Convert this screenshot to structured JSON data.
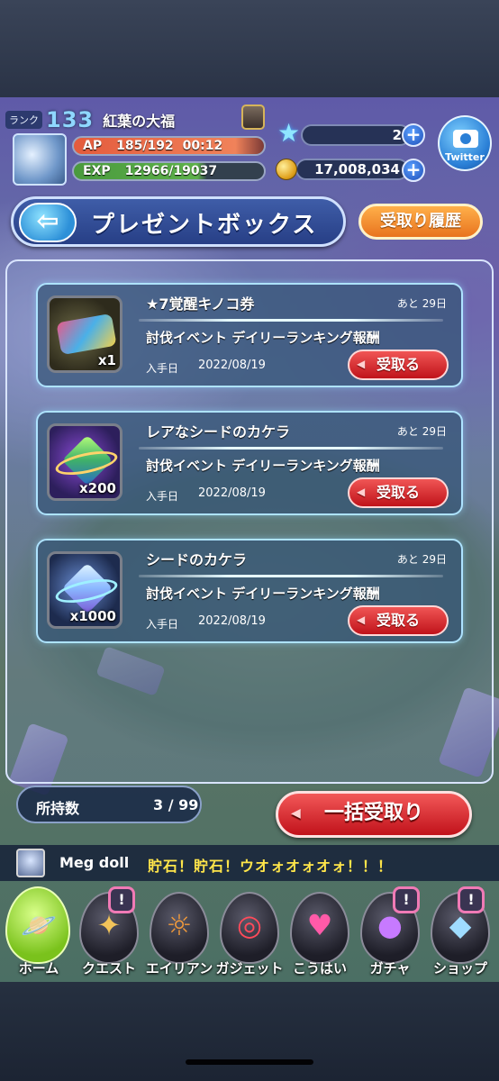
{
  "header": {
    "rank_label": "ランク",
    "rank_value": "133",
    "player_name": "紅葉の大福",
    "ap_label": "AP",
    "ap_value": "185/192",
    "ap_timer": "00:12",
    "exp_label": "EXP",
    "exp_value": "12966/19037",
    "gems": "2",
    "coins": "17,008,034",
    "twitter_label": "Twitter"
  },
  "page": {
    "title": "プレゼントボックス",
    "history_button": "受取り履歴"
  },
  "presents": [
    {
      "name": "★7覚醒キノコ券",
      "remaining": "あと 29日",
      "source": "討伐イベント デイリーランキング報酬",
      "date_label": "入手日",
      "date": "2022/08/19",
      "quantity": "x1",
      "button": "受取る"
    },
    {
      "name": "レアなシードのカケラ",
      "remaining": "あと 29日",
      "source": "討伐イベント デイリーランキング報酬",
      "date_label": "入手日",
      "date": "2022/08/19",
      "quantity": "x200",
      "button": "受取る"
    },
    {
      "name": "シードのカケラ",
      "remaining": "あと 29日",
      "source": "討伐イベント デイリーランキング報酬",
      "date_label": "入手日",
      "date": "2022/08/19",
      "quantity": "x1000",
      "button": "受取る"
    }
  ],
  "footer": {
    "count_label": "所持数",
    "count_value": "3 / 99",
    "receive_all": "一括受取り"
  },
  "chat": {
    "user": "Meg doll",
    "message": "貯石！貯石！ウオォオォオォ！！！"
  },
  "nav": [
    {
      "label": "ホーム",
      "icon": "planet-icon",
      "badge": ""
    },
    {
      "label": "クエスト",
      "icon": "sword-icon",
      "badge": "!"
    },
    {
      "label": "エイリアン",
      "icon": "alien-icon",
      "badge": ""
    },
    {
      "label": "ガジェット",
      "icon": "ring-icon",
      "badge": ""
    },
    {
      "label": "こうはい",
      "icon": "hearts-icon",
      "badge": ""
    },
    {
      "label": "ガチャ",
      "icon": "creature-icon",
      "badge": "!"
    },
    {
      "label": "ショップ",
      "icon": "gem-icon",
      "badge": "!"
    }
  ]
}
